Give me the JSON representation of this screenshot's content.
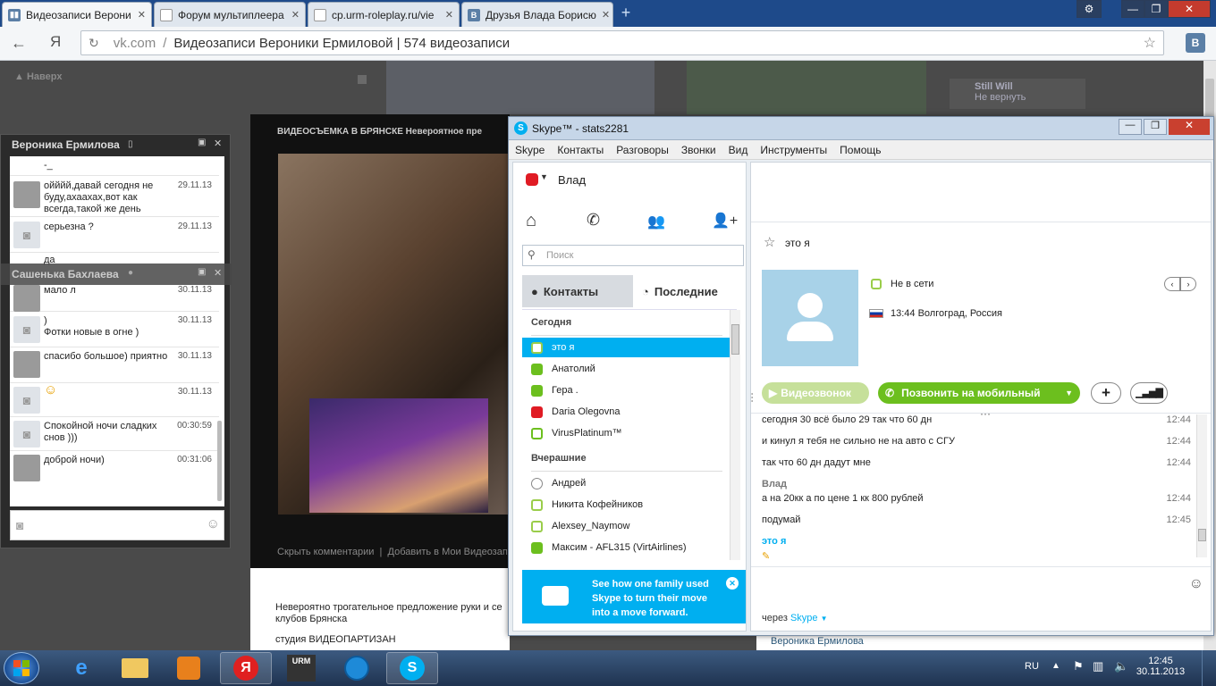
{
  "browser": {
    "tabs": [
      {
        "title": "Видеозаписи Верони",
        "fav": "vk-icon",
        "active": true
      },
      {
        "title": "Форум мультиплеера",
        "fav": "doc-icon",
        "active": false
      },
      {
        "title": "cp.urm-roleplay.ru/vie",
        "fav": "doc-icon",
        "active": false
      },
      {
        "title": "Друзья Влада Борисю",
        "fav": "vk-icon",
        "active": false
      }
    ],
    "new_tab": "+",
    "window_buttons": {
      "settings": "⚙",
      "minimize": "—",
      "maximize": "❐",
      "close": "✕"
    },
    "address": {
      "domain": "vk.com",
      "separator": "/",
      "title": "Видеозаписи Вероники Ермиловой | 574 видеозаписи"
    },
    "ya_label": "Я"
  },
  "vk": {
    "back_to_top": "Наверх",
    "suggest_title": "Still Will",
    "suggest_sub": "Не вернуть",
    "video_title": "ВИДЕОСЪЕМКА В БРЯНСКЕ Невероятное пре",
    "video_links": "Скрыть комментарии  |  Добавить в Мои Видеозапи",
    "desc_line1": "Невероятно трогательное предложение руки и се",
    "desc_line2": "клубов Брянска",
    "desc_line3": "студия ВИДЕОПАРТИЗАН",
    "author_bottom": "Вероника Ермилова",
    "chat1_name": "Вероника Ермилова",
    "chat2_name": "Сашенька Бахлаева",
    "messages": [
      {
        "text": "-_",
        "time": "",
        "cam": false
      },
      {
        "text": "ойййй,давай сегодня не буду,ахаахах,вот как всегда,такой же день",
        "time": "29.11.13",
        "cam": false
      },
      {
        "text": "серьезна ?",
        "time": "29.11.13",
        "cam": true
      },
      {
        "text": "да",
        "time": "",
        "cam": false
      },
      {
        "text": "мало л",
        "time": "30.11.13",
        "cam": false
      },
      {
        "text": ")\nФотки новые в огне )",
        "time": "30.11.13",
        "cam": true
      },
      {
        "text": "спасибо большое) приятно",
        "time": "30.11.13",
        "cam": false
      },
      {
        "text": "☺",
        "time": "30.11.13",
        "cam": true
      },
      {
        "text": "Спокойной ночи сладких снов )))",
        "time": "00:30:59",
        "cam": true
      },
      {
        "text": "доброй ночи)",
        "time": "00:31:06",
        "cam": false
      }
    ]
  },
  "skype": {
    "title": "Skype™ - stats2281",
    "menu": [
      "Skype",
      "Контакты",
      "Разговоры",
      "Звонки",
      "Вид",
      "Инструменты",
      "Помощь"
    ],
    "user": "Влад",
    "search_placeholder": "Поиск",
    "tab_contacts": "Контакты",
    "tab_recent": "Последние",
    "section_today": "Сегодня",
    "section_yesterday": "Вчерашние",
    "contacts_today": [
      {
        "name": "это я",
        "status": "off"
      },
      {
        "name": "Анатолий",
        "status": "on"
      },
      {
        "name": "Гера .",
        "status": "on"
      },
      {
        "name": "Daria Olegovna",
        "status": "dnd"
      },
      {
        "name": "VirusPlatinum™",
        "status": "fwd"
      }
    ],
    "contacts_yesterday": [
      {
        "name": "Андрей",
        "status": "q"
      },
      {
        "name": "Никита Кофейников",
        "status": "off"
      },
      {
        "name": "Alexsey_Naymow",
        "status": "off"
      },
      {
        "name": "Максим - AFL315 (VirtAirlines)",
        "status": "on"
      }
    ],
    "promo": "See how one family used Skype to turn their move into a move forward.",
    "profile_name": "это я",
    "profile_status": "Не в сети",
    "profile_location": "13:44 Волгоград, Россия",
    "btn_video": "Видеозвонок",
    "btn_call": "Позвонить на мобильный",
    "btn_add": "+",
    "conversation": [
      {
        "sender": "",
        "text": "сегодня 30 всё было 29 так что 60 дн",
        "time": "12:44"
      },
      {
        "sender": "",
        "text": "и кинул я тебя не сильно не на авто с СГУ",
        "time": "12:44"
      },
      {
        "sender": "",
        "text": "так что 60 дн дадут мне",
        "time": "12:44"
      },
      {
        "sender": "Влад",
        "text": "а на 20кк а по цене 1 кк 800 рублей",
        "time": "12:44"
      },
      {
        "sender": "",
        "text": "подумай",
        "time": "12:45"
      }
    ],
    "typing_name": "это я",
    "via_label": "через",
    "via_value": "Skype"
  },
  "taskbar": {
    "lang": "RU",
    "time": "12:45",
    "date": "30.11.2013"
  },
  "colors": {
    "skype_blue": "#00aff0",
    "skype_green": "#6cbf1e",
    "vk_blue": "#5b7fa6"
  }
}
